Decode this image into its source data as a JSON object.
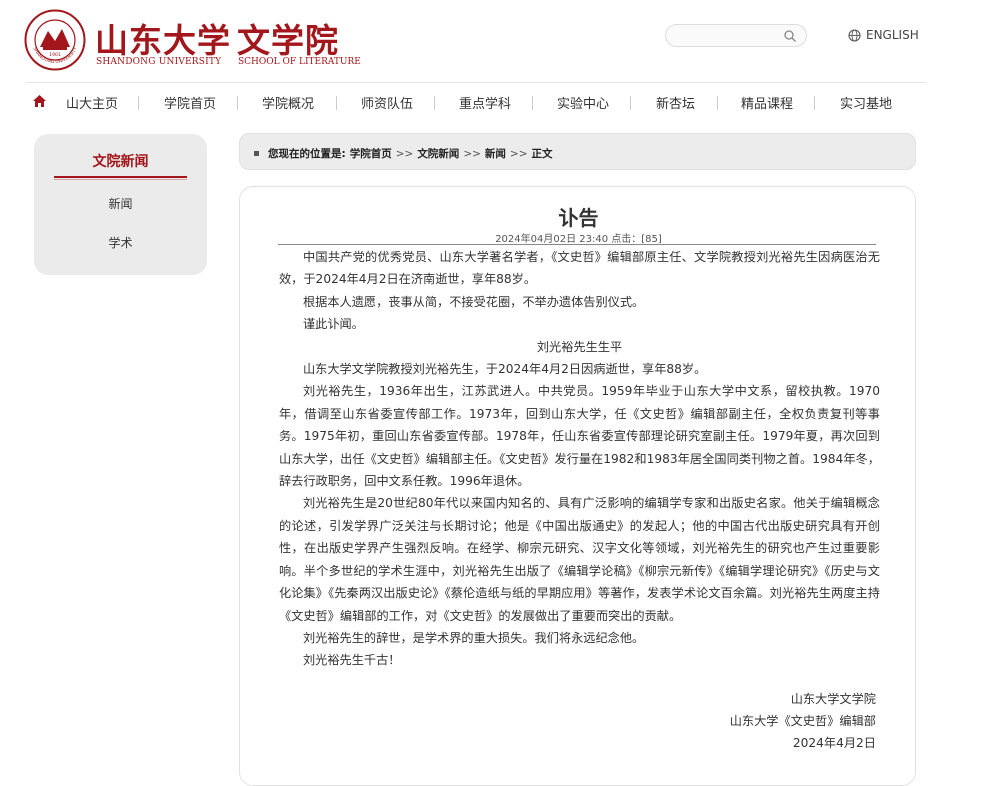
{
  "header": {
    "seal_text": "SHANDONG UNIVERSITY 1901",
    "university_cn": "山东大学",
    "university_en": "SHANDONG UNIVERSITY",
    "school_cn": "文学院",
    "school_en": "SCHOOL OF LITERATURE",
    "search_placeholder": "",
    "lang_label": "ENGLISH",
    "brand_color": "#a3161b"
  },
  "nav": {
    "items": [
      "山大主页",
      "学院首页",
      "学院概况",
      "师资队伍",
      "重点学科",
      "实验中心",
      "新杏坛",
      "精品课程",
      "实习基地"
    ]
  },
  "sidebar": {
    "title": "文院新闻",
    "items": [
      "新闻",
      "学术"
    ]
  },
  "breadcrumb": {
    "prefix": "您现在的位置是:",
    "items": [
      "学院首页",
      "文院新闻",
      "新闻",
      "正文"
    ],
    "separator": ">>"
  },
  "article": {
    "title": "讣告",
    "meta": "2024年04月02日 23:40  点击：[85]",
    "paragraphs": [
      "中国共产党的优秀党员、山东大学著名学者，《文史哲》编辑部原主任、文学院教授刘光裕先生因病医治无效，于2024年4月2日在济南逝世，享年88岁。",
      "根据本人遗愿，丧事从简，不接受花圈，不举办遗体告别仪式。",
      "谨此讣闻。"
    ],
    "bio_heading": "刘光裕先生生平",
    "bio_paragraphs": [
      "山东大学文学院教授刘光裕先生，于2024年4月2日因病逝世，享年88岁。",
      "刘光裕先生，1936年出生，江苏武进人。中共党员。1959年毕业于山东大学中文系，留校执教。1970年，借调至山东省委宣传部工作。1973年，回到山东大学，任《文史哲》编辑部副主任，全权负责复刊等事务。1975年初，重回山东省委宣传部。1978年，任山东省委宣传部理论研究室副主任。1979年夏，再次回到山东大学，出任《文史哲》编辑部主任。《文史哲》发行量在1982和1983年居全国同类刊物之首。1984年冬，辞去行政职务，回中文系任教。1996年退休。",
      "刘光裕先生是20世纪80年代以来国内知名的、具有广泛影响的编辑学专家和出版史名家。他关于编辑概念的论述，引发学界广泛关注与长期讨论；他是《中国出版通史》的发起人；他的中国古代出版史研究具有开创性，在出版史学界产生强烈反响。在经学、柳宗元研究、汉字文化等领域，刘光裕先生的研究也产生过重要影响。半个多世纪的学术生涯中，刘光裕先生出版了《编辑学论稿》《柳宗元新传》《编辑学理论研究》《历史与文化论集》《先秦两汉出版史论》《蔡伦造纸与纸的早期应用》等著作，发表学术论文百余篇。刘光裕先生两度主持《文史哲》编辑部的工作，对《文史哲》的发展做出了重要而突出的贡献。",
      "刘光裕先生的辞世，是学术界的重大损失。我们将永远纪念他。",
      "刘光裕先生千古！"
    ],
    "signature": [
      "山东大学文学院",
      "山东大学《文史哲》编辑部",
      "2024年4月2日"
    ]
  }
}
